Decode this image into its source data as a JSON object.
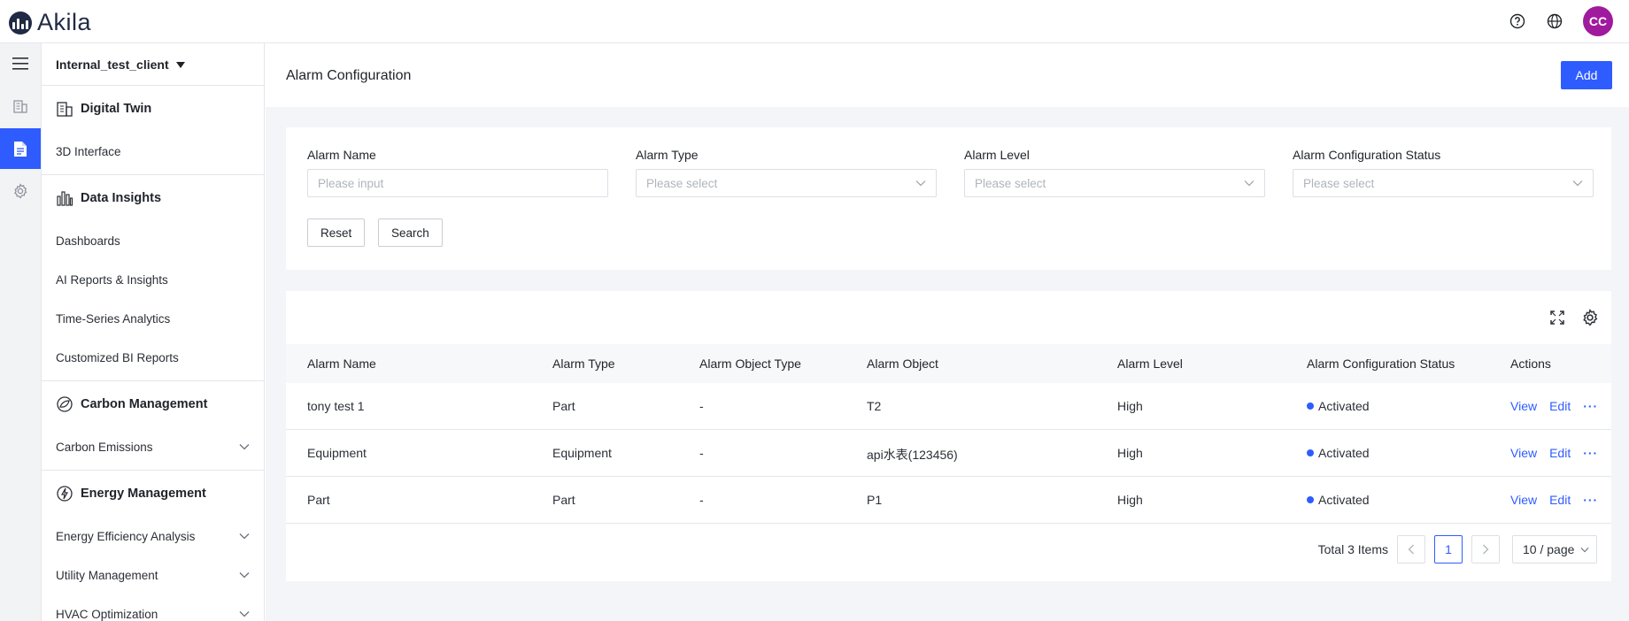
{
  "app": {
    "logo_text": "Akila"
  },
  "header": {
    "user_initials": "CC",
    "colors": {
      "avatar": "#a01a9e",
      "accent": "#2f5cff"
    }
  },
  "sidebar": {
    "client": "Internal_test_client",
    "sections": [
      {
        "title": "Digital Twin",
        "icon": "building-icon",
        "items": [
          {
            "label": "3D Interface"
          }
        ]
      },
      {
        "title": "Data Insights",
        "icon": "bar-chart-icon",
        "items": [
          {
            "label": "Dashboards"
          },
          {
            "label": "AI Reports & Insights"
          },
          {
            "label": "Time-Series Analytics"
          },
          {
            "label": "Customized BI Reports"
          }
        ]
      },
      {
        "title": "Carbon Management",
        "icon": "leaf-globe-icon",
        "items": [
          {
            "label": "Carbon Emissions",
            "expandable": true
          }
        ]
      },
      {
        "title": "Energy Management",
        "icon": "energy-icon",
        "items": [
          {
            "label": "Energy Efficiency Analysis",
            "expandable": true
          },
          {
            "label": "Utility Management",
            "expandable": true
          },
          {
            "label": "HVAC Optimization",
            "expandable": true
          }
        ]
      }
    ]
  },
  "page": {
    "title": "Alarm Configuration",
    "add_label": "Add"
  },
  "filters": {
    "fields": [
      {
        "label": "Alarm Name",
        "placeholder": "Please input"
      },
      {
        "label": "Alarm Type",
        "placeholder": "Please select"
      },
      {
        "label": "Alarm Level",
        "placeholder": "Please select"
      },
      {
        "label": "Alarm Configuration Status",
        "placeholder": "Please select"
      }
    ],
    "reset_label": "Reset",
    "search_label": "Search"
  },
  "table": {
    "columns": [
      "Alarm Name",
      "Alarm Type",
      "Alarm Object Type",
      "Alarm Object",
      "Alarm Level",
      "Alarm Configuration Status",
      "Actions"
    ],
    "rows": [
      {
        "name": "tony test 1",
        "type": "Part",
        "object_type": "-",
        "object": "T2",
        "level": "High",
        "status": "Activated",
        "view": "View",
        "edit": "Edit",
        "more": "···"
      },
      {
        "name": "Equipment",
        "type": "Equipment",
        "object_type": "-",
        "object": "api水表(123456)",
        "level": "High",
        "status": "Activated",
        "view": "View",
        "edit": "Edit",
        "more": "···"
      },
      {
        "name": "Part",
        "type": "Part",
        "object_type": "-",
        "object": "P1",
        "level": "High",
        "status": "Activated",
        "view": "View",
        "edit": "Edit",
        "more": "···"
      }
    ]
  },
  "pagination": {
    "total_text": "Total 3 Items",
    "current_page": "1",
    "page_size": "10 / page"
  }
}
